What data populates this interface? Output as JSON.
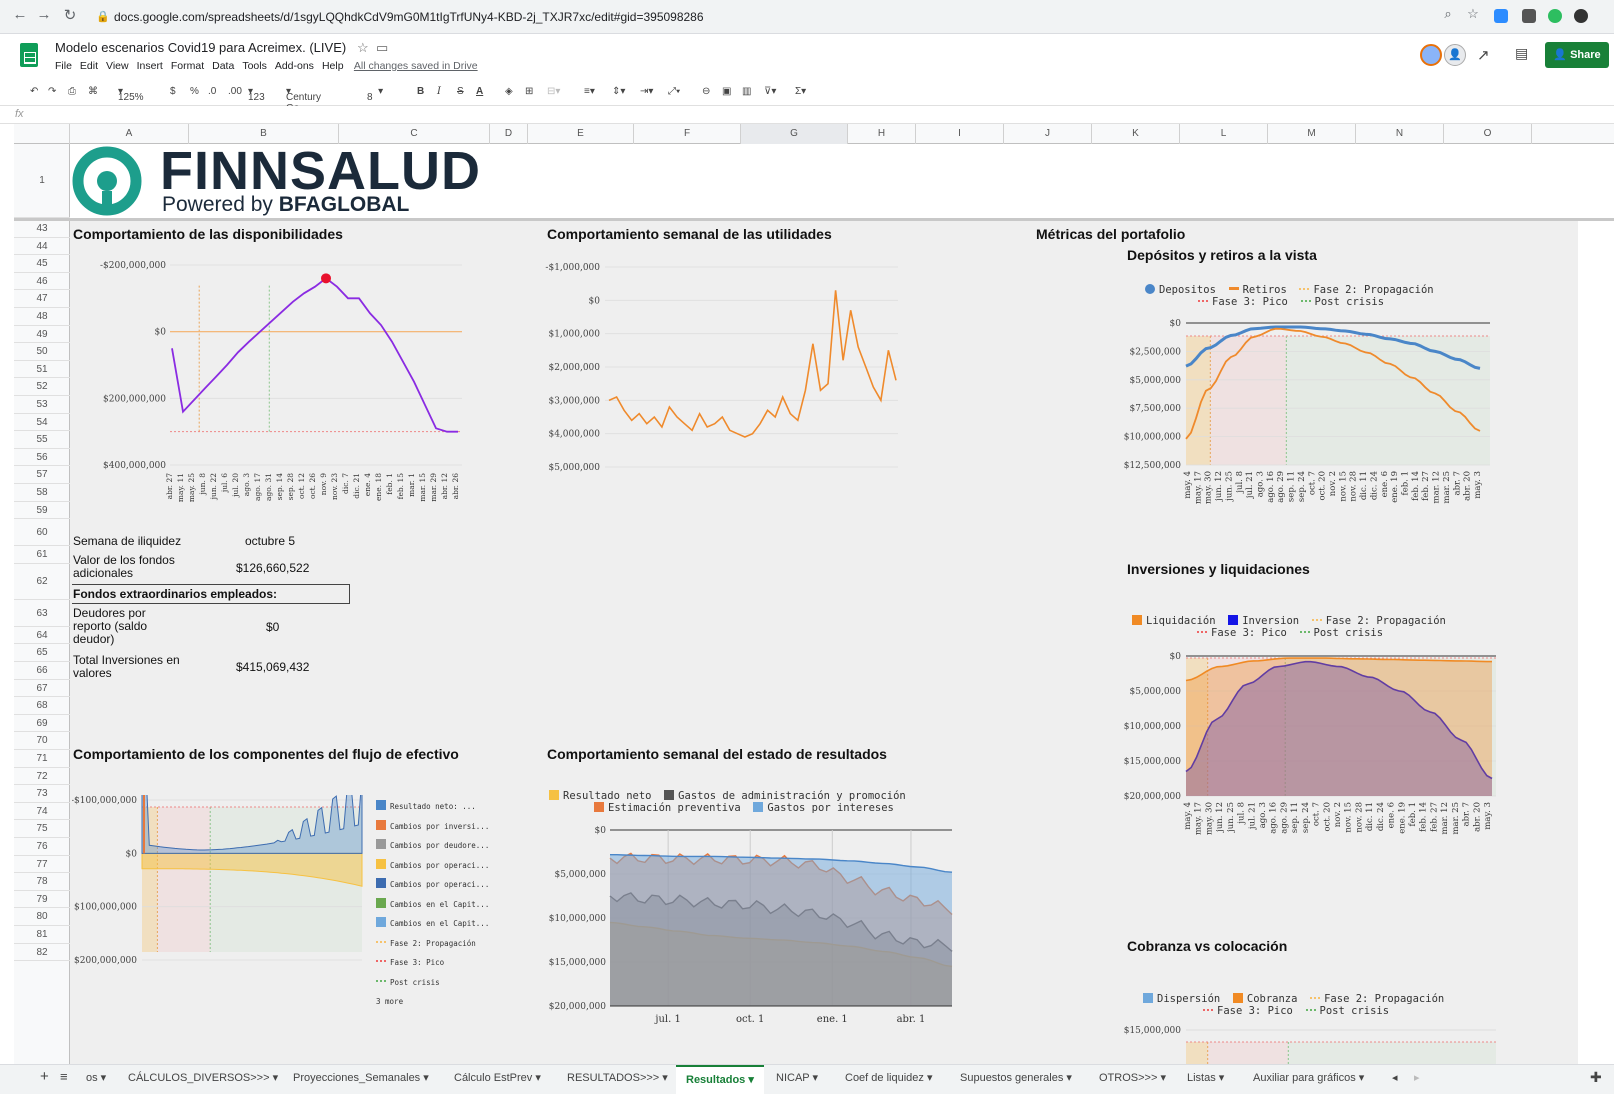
{
  "browser": {
    "url": "docs.google.com/spreadsheets/d/1sgyLQQhdkCdV9mG0M1tIgTrfUNy4-KBD-2j_TXJR7xc/edit#gid=395098286"
  },
  "app": {
    "title": "Modelo escenarios Covid19 para Acreimex. (LIVE)",
    "menu": [
      "File",
      "Edit",
      "View",
      "Insert",
      "Format",
      "Data",
      "Tools",
      "Add-ons",
      "Help"
    ],
    "saved_status": "All changes saved in Drive",
    "share_label": "Share"
  },
  "toolbar": {
    "zoom": "125%",
    "currency": "$",
    "percent": "%",
    "dec_less": ".0",
    "dec_more": ".00",
    "format": "123",
    "font": "Century Go...",
    "size": "8",
    "bold": "B",
    "italic": "I",
    "strike": "S",
    "textcolor": "A"
  },
  "formula": {
    "fx": "fx"
  },
  "columns": [
    "A",
    "B",
    "C",
    "D",
    "E",
    "F",
    "G",
    "H",
    "I",
    "J",
    "K",
    "L",
    "M",
    "N",
    "O"
  ],
  "rows": [
    "1",
    "43",
    "44",
    "45",
    "46",
    "47",
    "48",
    "49",
    "50",
    "51",
    "52",
    "53",
    "54",
    "55",
    "56",
    "57",
    "58",
    "59",
    "60",
    "61",
    "62",
    "63",
    "64",
    "65",
    "66",
    "67",
    "68",
    "69",
    "70",
    "71",
    "72",
    "73",
    "74",
    "75",
    "76",
    "77",
    "78",
    "79",
    "80",
    "81",
    "82"
  ],
  "logo": {
    "name": "FINNSALUD",
    "tagline_pre": "Powered by ",
    "tagline_brand": "BFAGLOBAL"
  },
  "cells": {
    "semana_label": "Semana de iliquidez",
    "semana_value": "octubre 5",
    "valor_label": "Valor de los fondos adicionales",
    "valor_value": "$126,660,522",
    "fondos_label": "Fondos extraordinarios empleados:",
    "deudores_label": "Deudores por reporto (saldo deudor)",
    "deudores_value": "$0",
    "total_label": "Total Inversiones en valores",
    "total_value": "$415,069,432"
  },
  "charts": {
    "disponibilidades": {
      "title": "Comportamiento de las disponibilidades"
    },
    "utilidades": {
      "title": "Comportamiento semanal de las utilidades"
    },
    "portafolio": {
      "title": "Métricas del portafolio"
    },
    "depositos": {
      "title": "Depósitos y retiros a la vista"
    },
    "flujo": {
      "title": "Comportamiento de los componentes del flujo de efectivo"
    },
    "resultados": {
      "title": "Comportamiento semanal del estado de resultados"
    },
    "inversiones": {
      "title": "Inversiones y liquidaciones"
    },
    "cobranza": {
      "title": "Cobranza vs colocación"
    }
  },
  "chart_data": [
    {
      "type": "line",
      "title": "Comportamiento de las disponibilidades",
      "ylim": [
        -200000000,
        400000000
      ],
      "yticks": [
        "$400,000,000",
        "$200,000,000",
        "$0",
        "-$200,000,000"
      ],
      "categories": [
        "abr. 27",
        "may. 11",
        "may. 25",
        "jun. 8",
        "jun. 22",
        "jul. 6",
        "jul. 20",
        "ago. 3",
        "ago. 17",
        "ago. 31",
        "sep. 14",
        "sep. 28",
        "oct. 12",
        "oct. 26",
        "nov. 9",
        "nov. 23",
        "dic. 7",
        "dic. 21",
        "ene. 4",
        "ene. 18",
        "feb. 1",
        "feb. 15",
        "mar. 1",
        "mar. 15",
        "mar. 29",
        "abr. 12",
        "abr. 26"
      ],
      "values": [
        50000000,
        240000000,
        205000000,
        170000000,
        135000000,
        100000000,
        62000000,
        30000000,
        0,
        -30000000,
        -60000000,
        -90000000,
        -115000000,
        -135000000,
        -160000000,
        -135000000,
        -100000000,
        -100000000,
        -55000000,
        -20000000,
        30000000,
        90000000,
        150000000,
        220000000,
        290000000,
        300000000,
        300000000
      ]
    },
    {
      "type": "line",
      "title": "Comportamiento semanal de las utilidades",
      "ylim": [
        -1000000,
        5000000
      ],
      "yticks": [
        "$5,000,000",
        "$4,000,000",
        "$3,000,000",
        "$2,000,000",
        "$1,000,000",
        "$0",
        "-$1,000,000"
      ],
      "values": [
        3000000,
        2900000,
        3300000,
        3600000,
        3400000,
        3700000,
        3500000,
        3800000,
        3200000,
        3500000,
        3700000,
        3900000,
        3400000,
        3800000,
        3700000,
        3500000,
        3900000,
        4000000,
        4100000,
        4000000,
        3700000,
        3300000,
        3500000,
        2900000,
        3400000,
        3600000,
        2700000,
        1300000,
        2700000,
        2500000,
        -300000,
        1800000,
        300000,
        1400000,
        2000000,
        2600000,
        3000000,
        1500000,
        2400000
      ]
    },
    {
      "type": "line",
      "title": "Depósitos y retiros a la vista",
      "ylim": [
        0,
        12500000
      ],
      "yticks": [
        "$12,500,000",
        "$10,000,000",
        "$7,500,000",
        "$5,000,000",
        "$2,500,000",
        "$0"
      ],
      "categories": [
        "may. 4",
        "may. 17",
        "may. 30",
        "jun. 12",
        "jun. 25",
        "jul. 8",
        "jul. 21",
        "ago. 3",
        "ago. 16",
        "ago. 29",
        "sep. 11",
        "sep. 24",
        "oct. 7",
        "oct. 20",
        "nov. 2",
        "nov. 15",
        "nov. 28",
        "dic. 11",
        "dic. 24",
        "ene. 6",
        "ene. 19",
        "feb. 1",
        "feb. 14",
        "feb. 27",
        "mar. 12",
        "mar. 25",
        "abr. 7",
        "abr. 20",
        "may. 3"
      ],
      "series": [
        {
          "name": "Depositos",
          "values": [
            3800000,
            2200000,
            1100000,
            500000,
            350000,
            350000,
            500000,
            700000,
            1000000,
            1400000,
            1800000,
            2500000,
            3200000,
            4000000
          ]
        },
        {
          "name": "Retiros",
          "values": [
            10200000,
            5800000,
            3000000,
            1200000,
            500000,
            700000,
            1200000,
            1800000,
            2600000,
            3600000,
            4800000,
            6200000,
            7800000,
            9500000
          ]
        },
        {
          "name": "Fase 2: Propagación"
        },
        {
          "name": "Fase 3: Pico"
        },
        {
          "name": "Post crisis"
        }
      ]
    },
    {
      "type": "area",
      "title": "Inversiones y liquidaciones",
      "ylim": [
        0,
        20000000
      ],
      "yticks": [
        "$20,000,000",
        "$15,000,000",
        "$10,000,000",
        "$5,000,000",
        "$0"
      ],
      "categories": [
        "may. 4",
        "may. 17",
        "may. 30",
        "jun. 12",
        "jun. 25",
        "jul. 8",
        "jul. 21",
        "ago. 3",
        "ago. 16",
        "ago. 29",
        "sep. 11",
        "sep. 24",
        "oct. 7",
        "oct. 20",
        "nov. 2",
        "nov. 15",
        "nov. 28",
        "dic. 11",
        "dic. 24",
        "ene. 6",
        "ene. 19",
        "feb. 1",
        "feb. 14",
        "feb. 27",
        "mar. 12",
        "mar. 25",
        "abr. 7",
        "abr. 20",
        "may. 3"
      ],
      "series": [
        {
          "name": "Liquidación",
          "values": [
            3500000,
            1500000,
            700000,
            300000,
            300000,
            400000,
            500000,
            600000,
            700000,
            800000
          ]
        },
        {
          "name": "Inversion",
          "values": [
            16500000,
            9000000,
            4000000,
            1500000,
            800000,
            1500000,
            3000000,
            5000000,
            8000000,
            12000000,
            17500000
          ]
        },
        {
          "name": "Fase 2: Propagación"
        },
        {
          "name": "Fase 3: Pico"
        },
        {
          "name": "Post crisis"
        }
      ]
    },
    {
      "type": "area",
      "title": "Comportamiento semanal del estado de resultados",
      "ylim": [
        0,
        20000000
      ],
      "yticks": [
        "$20,000,000",
        "$15,000,000",
        "$10,000,000",
        "$5,000,000",
        "$0"
      ],
      "xticks": [
        "jul. 1",
        "oct. 1",
        "ene. 1",
        "abr. 1"
      ],
      "series": [
        {
          "name": "Resultado neto",
          "values": [
            10500000,
            11000000,
            11500000,
            12000000,
            12300000,
            12500000,
            12800000,
            13200000,
            13800000,
            14500000,
            15500000
          ]
        },
        {
          "name": "Gastos de administración y promoción",
          "values": [
            7500000,
            7800000,
            8000000,
            8300000,
            8500000,
            9000000,
            9500000,
            10500000,
            12000000,
            12800000,
            13200000
          ]
        },
        {
          "name": "Estimación preventiva",
          "values": [
            3200000,
            3200000,
            3300000,
            3300000,
            3400000,
            3500000,
            4000000,
            5500000,
            7000000,
            8000000,
            9000000
          ]
        },
        {
          "name": "Gastos por intereses",
          "values": [
            2800000,
            2900000,
            3000000,
            3000000,
            3100000,
            3200000,
            3300000,
            3500000,
            3800000,
            4200000,
            4800000
          ]
        }
      ]
    },
    {
      "type": "area",
      "title": "Comportamiento de los componentes del flujo de efectivo",
      "ylim": [
        -100000000,
        200000000
      ],
      "yticks": [
        "$200,000,000",
        "$100,000,000",
        "$0",
        "-$100,000,000"
      ],
      "legend": [
        "Resultado neto: ...",
        "Cambios por inversi...",
        "Cambios por deudore...",
        "Cambios por operaci...",
        "Cambios por operaci...",
        "Cambios en el Capit...",
        "Cambios en el Capit...",
        "Fase 2: Propagación",
        "Fase 3: Pico",
        "Post crisis",
        "3 more"
      ]
    },
    {
      "type": "line",
      "title": "Cobranza vs colocación",
      "yticks": [
        "$15,000,000"
      ],
      "series": [
        {
          "name": "Dispersión"
        },
        {
          "name": "Cobranza"
        },
        {
          "name": "Fase 2: Propagación"
        },
        {
          "name": "Fase 3: Pico"
        },
        {
          "name": "Post crisis"
        }
      ]
    }
  ],
  "tabs": [
    "os",
    "CÁLCULOS_DIVERSOS>>>",
    "Proyecciones_Semanales",
    "Cálculo EstPrev",
    "RESULTADOS>>>",
    "Resultados",
    "NICAP",
    "Coef de liquidez",
    "Supuestos generales",
    "OTROS>>>",
    "Listas",
    "Auxiliar para gráficos"
  ],
  "colors": {
    "accent": "#188038",
    "purple": "#8a2be2",
    "orange": "#ef8a2c",
    "blue": "#4a86c8",
    "deep_blue": "#1515e6"
  }
}
